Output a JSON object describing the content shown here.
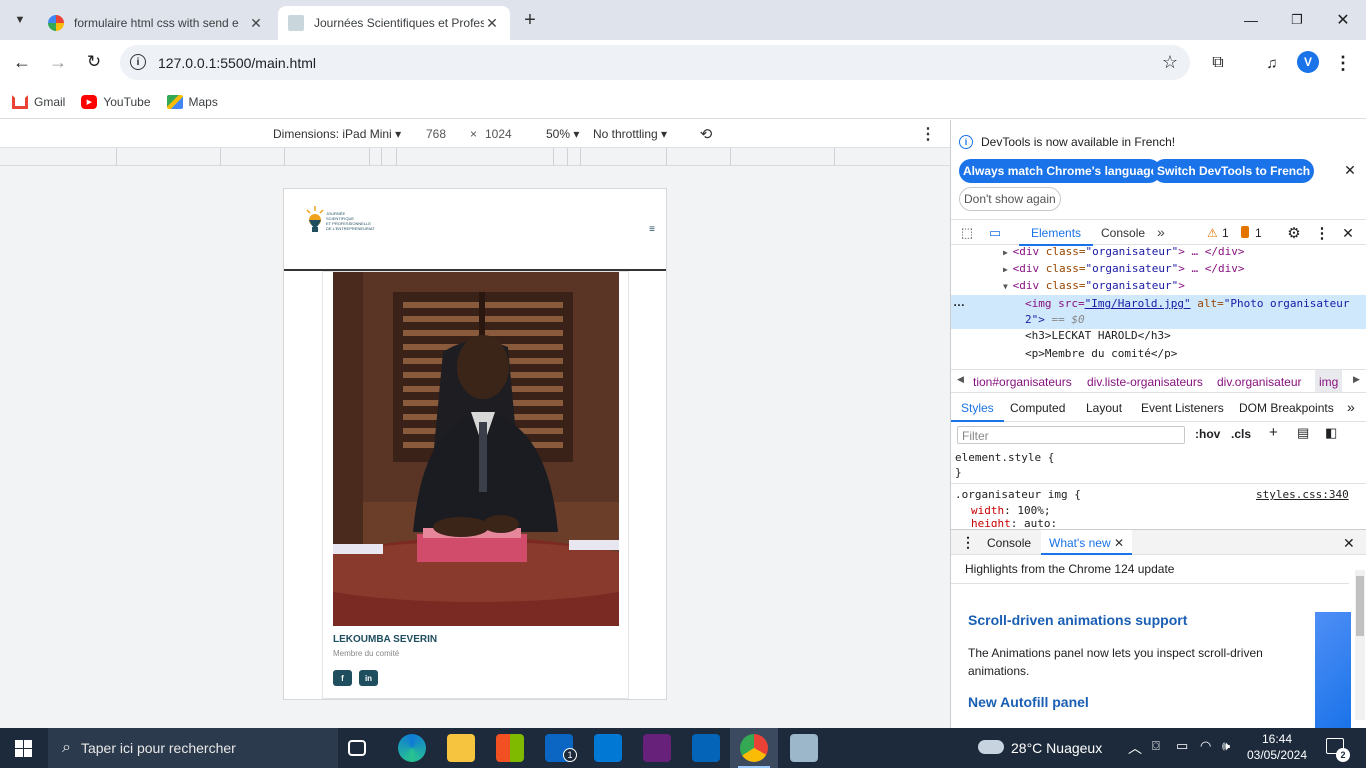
{
  "browser": {
    "tabs": [
      {
        "title": "formulaire html css with send e",
        "active": false
      },
      {
        "title": "Journées Scientifiques et Profes",
        "active": true
      }
    ],
    "new_tab": "+",
    "url": "127.0.0.1:5500/main.html",
    "bookmarks": [
      "Gmail",
      "YouTube",
      "Maps"
    ],
    "profile_initial": "V"
  },
  "device_toolbar": {
    "dimensions_label": "Dimensions: iPad Mini",
    "width": "768",
    "times": "×",
    "height": "1024",
    "zoom": "50%",
    "throttling": "No throttling"
  },
  "site": {
    "logo_lines": [
      "JOURNÉE",
      "SCIENTIFIQUE",
      "ET PROFESSIONNELLE",
      "DE L'ENTREPRENEURIAT"
    ],
    "menu_icon": "≡",
    "organizer": {
      "name": "LEKOUMBA SEVERIN",
      "role": "Membre du comité"
    }
  },
  "devtools": {
    "banner_text": "DevTools is now available in French!",
    "btn_match": "Always match Chrome's language",
    "btn_switch": "Switch DevTools to French",
    "btn_dont_show": "Don't show again",
    "tabs": [
      "Elements",
      "Console"
    ],
    "warn_count": "1",
    "err_count": "1",
    "dom_lines": [
      {
        "pre": "",
        "tag_open": "<div ",
        "attr": "class=",
        "val": "\"organisateur\"",
        "tail": "> … </div>"
      },
      {
        "pre": "",
        "tag_open": "<div ",
        "attr": "class=",
        "val": "\"organisateur\"",
        "tail": "> … </div>"
      },
      {
        "pre": "",
        "tag_open": "<div ",
        "attr": "class=",
        "val": "\"organisateur\"",
        "tail": ">"
      }
    ],
    "img_line_1a": "<img src=",
    "img_src": "\"Img/Harold.jpg\"",
    "img_line_1b": " alt=",
    "img_alt": "\"Photo organisateur",
    "img_line_2": "2\">",
    "img_eq": "== $0",
    "h3_line": "<h3>LECKAT HAROLD</h3>",
    "p_line": "<p>Membre du comité</p>",
    "breadcrumbs": [
      "tion#organisateurs",
      "div.liste-organisateurs",
      "div.organisateur",
      "img"
    ],
    "style_tabs": [
      "Styles",
      "Computed",
      "Layout",
      "Event Listeners",
      "DOM Breakpoints"
    ],
    "filter_placeholder": "Filter",
    "hov": ":hov",
    "cls": ".cls",
    "element_style": "element.style {",
    "close_brace": "}",
    "selector": ".organisateur img {",
    "source": "styles.css:340",
    "decl1_prop": "width",
    "decl1_val": "100%;",
    "decl2_prop": "height",
    "decl2_val": "auto;",
    "drawer_tabs": [
      "Console",
      "What's new"
    ],
    "highlights": "Highlights from the Chrome 124 update",
    "wn_title1": "Scroll-driven animations support",
    "wn_text1": "The Animations panel now lets you inspect scroll-driven animations.",
    "wn_title2": "New Autofill panel"
  },
  "taskbar": {
    "search_placeholder": "Taper ici pour rechercher",
    "weather": "28°C  Nuageux",
    "time": "16:44",
    "date": "03/05/2024",
    "notif_count": "2",
    "mail_badge": "1"
  },
  "colors": {
    "accent": "#1a73e8",
    "brand_teal": "#1f4e5f",
    "taskbar": "#1c2a3b"
  }
}
